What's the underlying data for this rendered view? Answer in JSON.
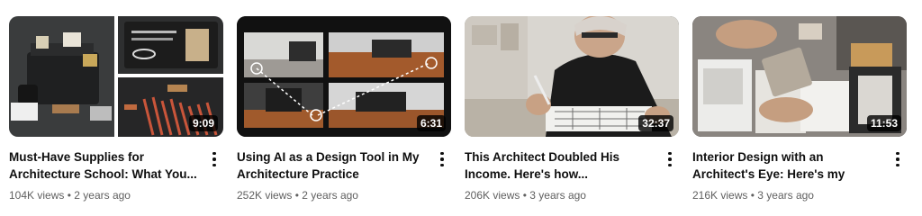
{
  "videos": [
    {
      "title": "Must-Have Supplies for Architecture School: What You...",
      "views": "104K views",
      "separator": "•",
      "age": "2 years ago",
      "duration": "9:09",
      "thumbnail_icon": "architecture-supplies-thumbnail"
    },
    {
      "title": "Using AI as a Design Tool in My Architecture Practice",
      "views": "252K views",
      "separator": "•",
      "age": "2 years ago",
      "duration": "6:31",
      "thumbnail_icon": "ai-design-images-thumbnail"
    },
    {
      "title": "This Architect Doubled His Income. Here's how...",
      "views": "206K views",
      "separator": "•",
      "age": "3 years ago",
      "duration": "32:37",
      "thumbnail_icon": "architect-drawing-thumbnail"
    },
    {
      "title": "Interior Design with an Architect's Eye: Here's my Process",
      "views": "216K views",
      "separator": "•",
      "age": "3 years ago",
      "duration": "11:53",
      "thumbnail_icon": "material-samples-thumbnail"
    }
  ],
  "colors": {
    "title": "#0f0f0f",
    "meta": "#606060",
    "duration_bg": "#000000cc"
  }
}
